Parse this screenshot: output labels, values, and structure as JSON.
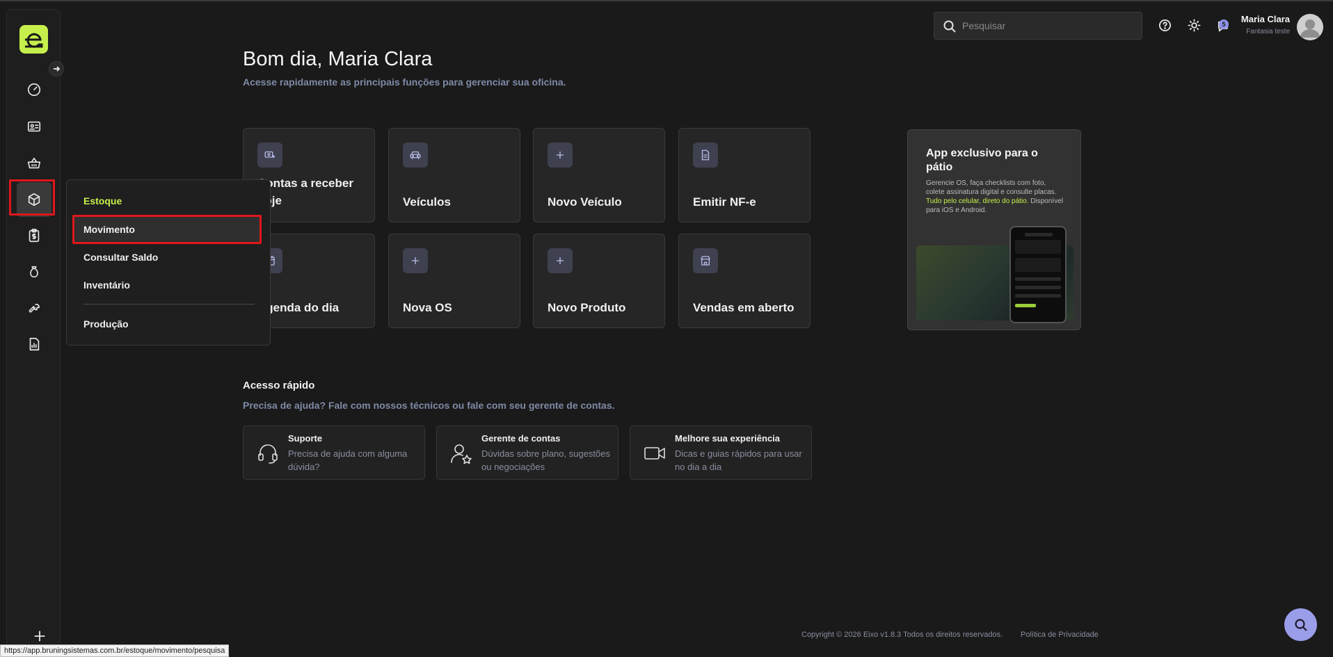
{
  "header": {
    "search_placeholder": "Pesquisar",
    "notification_count": "5",
    "user_name": "Maria Clara",
    "user_company": "Fantasia teste"
  },
  "flyout": {
    "title": "Estoque",
    "items": [
      "Movimento",
      "Consultar Saldo",
      "Inventário"
    ],
    "extra": "Produção"
  },
  "main": {
    "greeting": "Bom dia, Maria Clara",
    "subtitle": "Acesse rapidamente as principais funções para gerenciar sua oficina."
  },
  "cards": [
    {
      "label": "Contas a receber hoje",
      "icon": "money-receive-icon"
    },
    {
      "label": "Veículos",
      "icon": "car-icon"
    },
    {
      "label": "Novo Veículo",
      "icon": "plus-icon"
    },
    {
      "label": "Emitir NF-e",
      "icon": "document-icon"
    },
    {
      "label": "Agenda do dia",
      "icon": "calendar-icon"
    },
    {
      "label": "Nova OS",
      "icon": "plus-icon"
    },
    {
      "label": "Novo Produto",
      "icon": "plus-icon"
    },
    {
      "label": "Vendas em aberto",
      "icon": "store-icon"
    }
  ],
  "promo": {
    "title": "App exclusivo para o pátio",
    "text_part1": "Gerencie OS, faça checklists com foto, colete assinatura digital e consulte placas. ",
    "text_highlight": "Tudo pelo celular, direto do pátio.",
    "text_part2": " Disponível para iOS e Android."
  },
  "quick_access": {
    "title": "Acesso rápido",
    "subtitle": "Precisa de ajuda? Fale com nossos técnicos ou fale com seu gerente de contas.",
    "items": [
      {
        "name": "Suporte",
        "desc": "Precisa de ajuda com alguma dúvida?"
      },
      {
        "name": "Gerente de contas",
        "desc": "Dúvidas sobre plano, sugestões ou negociações"
      },
      {
        "name": "Melhore sua experiência",
        "desc": "Dicas e guias rápidos para usar no dia a dia"
      }
    ]
  },
  "footer": {
    "copyright": "Copyright © 2026 Eixo v1.8.3 Todos os direitos reservados.",
    "privacy": "Política de Privacidade"
  },
  "status_url": "https://app.bruningsistemas.com.br/estoque/movimento/pesquisa",
  "colors": {
    "accent": "#c6ef4c",
    "highlight_border": "#e0161b",
    "fab": "#9a9de8"
  }
}
